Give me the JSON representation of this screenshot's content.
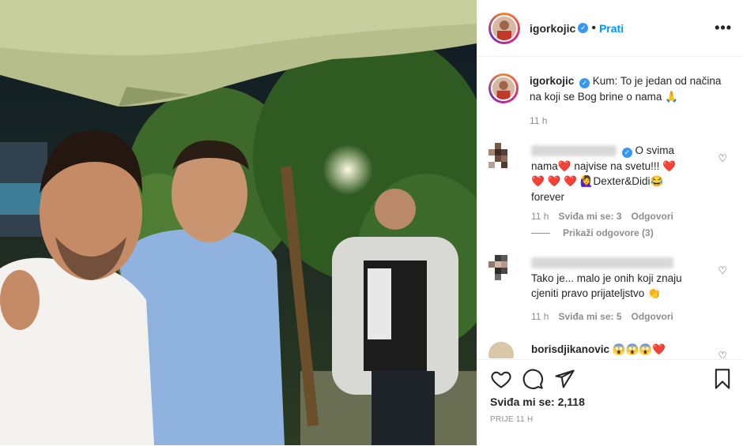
{
  "post": {
    "username": "igorkojic",
    "follow_label": "Prati",
    "more_label": "•••",
    "verified_mark": "✓",
    "dot_separator": "•",
    "caption_text": "Kum: To je jedan od načina na koji se Bog brine o nama 🙏",
    "caption_time": "11 h",
    "likes_label": "Sviđa mi se: 2,118",
    "posted_time": "PRIJE 11 H"
  },
  "comments": [
    {
      "text": "O svima nama❤️ najvise na svetu!!! ❤️ ❤️ ❤️ ❤️ 🙋‍♀️Dexter&Didi😂forever",
      "time": "11 h",
      "likes": "Sviđa mi se: 3",
      "reply": "Odgovori"
    },
    {
      "text": "Tako je... malo je onih koji znaju cjeniti pravo prijateljstvo 👏",
      "time": "11 h",
      "likes": "Sviđa mi se: 5",
      "reply": "Odgovori"
    },
    {
      "username": "borisdjikanovic",
      "text": "😱😱😱❤️"
    }
  ],
  "view_replies_label": "Prikaži odgovore (3)",
  "icons": {
    "like": "heart-icon",
    "comment": "comment-icon",
    "share": "paper-plane-icon",
    "save": "bookmark-icon",
    "comment_like": "small-heart-icon"
  },
  "colors": {
    "link_blue": "#0095f6",
    "verified_blue": "#3897f0",
    "muted_text": "#8e8e8e",
    "border": "#efefef"
  }
}
